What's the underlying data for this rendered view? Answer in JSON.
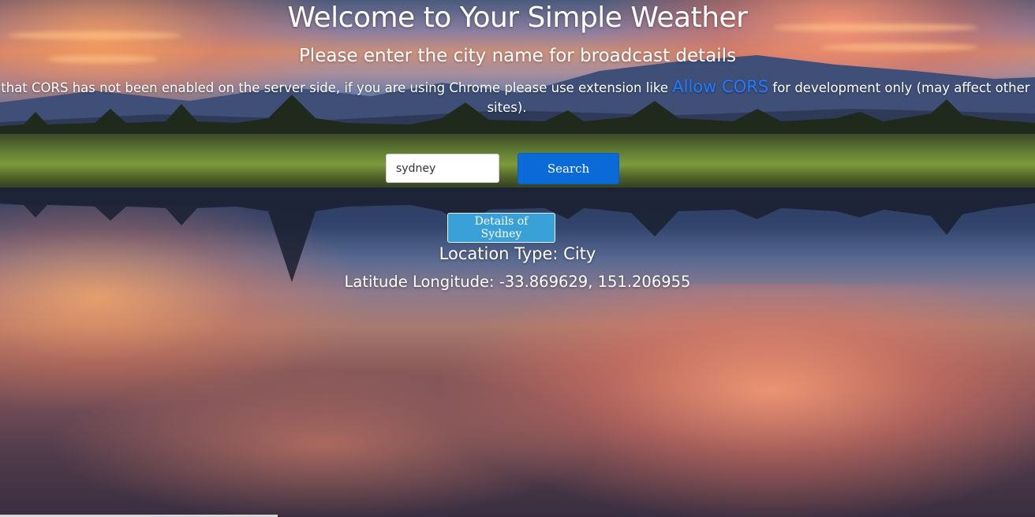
{
  "header": {
    "title": "Welcome to Your Simple Weather",
    "subtitle": "Please enter the city name for broadcast details"
  },
  "note": {
    "text_before": "te that CORS has not been enabled on the server side, if you are using Chrome please use extension like ",
    "link_label": "Allow CORS",
    "text_after": " for development only (may affect other sites)."
  },
  "search": {
    "value": "sydney",
    "placeholder": "",
    "button_label": "Search"
  },
  "details": {
    "button_label": "Details of Sydney",
    "location_type": "Location Type: City",
    "lat_lng": "Latitude Longitude: -33.869629, 151.206955"
  },
  "colors": {
    "search_button": "#0b6ad8",
    "details_button": "#3aa0d8",
    "link": "#1f7bff",
    "text": "#ffffff"
  }
}
